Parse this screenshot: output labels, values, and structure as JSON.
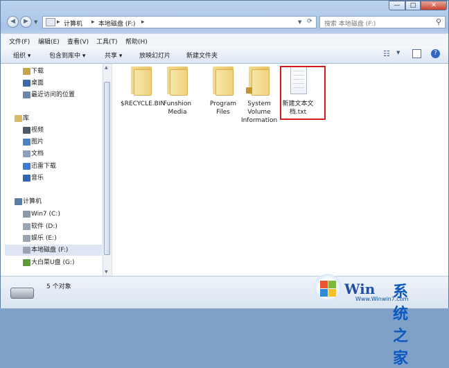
{
  "window": {
    "minimize": "—",
    "maximize": "□",
    "close": "✕"
  },
  "address": {
    "crumbs": [
      "计算机",
      "本地磁盘 (F:)"
    ],
    "search_placeholder": "搜索 本地磁盘 (F:)"
  },
  "menu": [
    "文件(F)",
    "编辑(E)",
    "查看(V)",
    "工具(T)",
    "帮助(H)"
  ],
  "toolbar": [
    "组织 ▾",
    "包含到库中 ▾",
    "共享 ▾",
    "放映幻灯片",
    "新建文件夹"
  ],
  "nav": {
    "items": [
      {
        "label": "下载",
        "icon": "download-folder-icon",
        "color": "#c9a447"
      },
      {
        "label": "桌面",
        "icon": "desktop-icon",
        "color": "#3a6aa8"
      },
      {
        "label": "最近访问的位置",
        "icon": "recent-places-icon",
        "color": "#6b86a8"
      },
      {
        "label": "库",
        "icon": "library-icon",
        "color": "#d9b86a"
      },
      {
        "label": "视频",
        "icon": "video-library-icon",
        "color": "#4e5a6a"
      },
      {
        "label": "图片",
        "icon": "pictures-library-icon",
        "color": "#4a84c2"
      },
      {
        "label": "文档",
        "icon": "documents-library-icon",
        "color": "#8aa0bd"
      },
      {
        "label": "迅雷下载",
        "icon": "thunder-download-icon",
        "color": "#3a7bd5"
      },
      {
        "label": "音乐",
        "icon": "music-library-icon",
        "color": "#2c66b4"
      },
      {
        "label": "计算机",
        "icon": "computer-icon",
        "color": "#5a7ba3"
      },
      {
        "label": "Win7 (C:)",
        "icon": "system-drive-icon",
        "color": "#8b99a8"
      },
      {
        "label": "软件 (D:)",
        "icon": "drive-icon",
        "color": "#9aa5b1"
      },
      {
        "label": "娱乐 (E:)",
        "icon": "drive-icon",
        "color": "#9aa5b1"
      },
      {
        "label": "本地磁盘 (F:)",
        "icon": "drive-icon",
        "color": "#9aa5b1"
      },
      {
        "label": "大白菜U盘 (G:)",
        "icon": "usb-drive-icon",
        "color": "#5c9a3a"
      }
    ]
  },
  "files": [
    {
      "name": "$RECYCLE.BIN",
      "type": "folder"
    },
    {
      "name": "Funshion Media",
      "type": "folder"
    },
    {
      "name": "Program Files",
      "type": "folder"
    },
    {
      "name": "System Volume Information",
      "type": "locked-folder"
    },
    {
      "name": "新建文本文档.txt",
      "type": "text"
    }
  ],
  "status": {
    "count": "5 个对象"
  },
  "watermark": {
    "brand1": "Win",
    "brand2": "系统之家",
    "url": "Www.Winwin7.com"
  }
}
